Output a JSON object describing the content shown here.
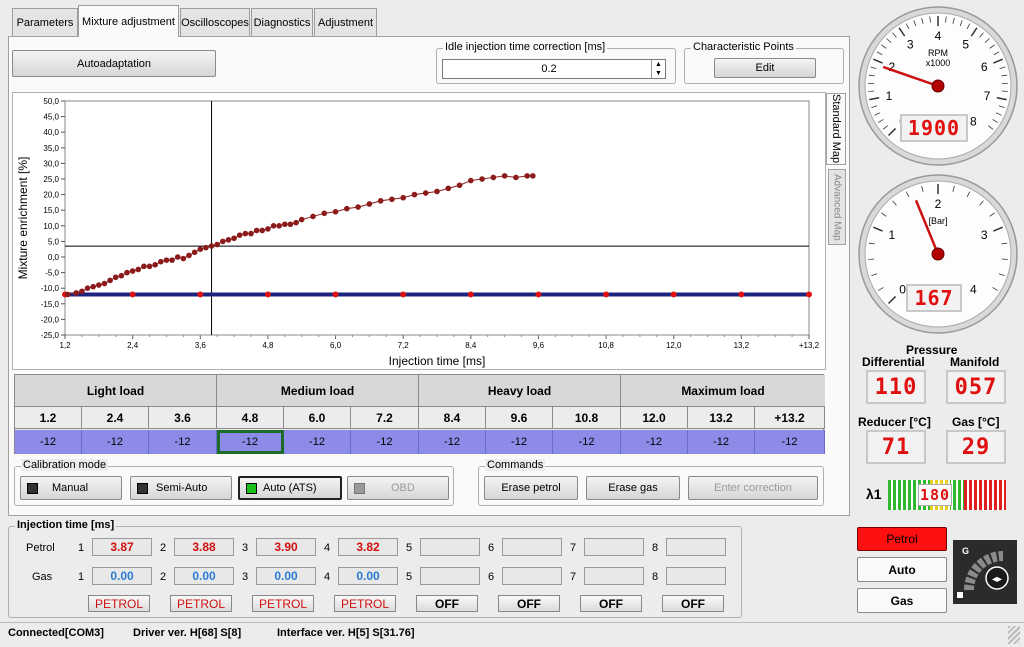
{
  "tabs": [
    "Parameters",
    "Mixture adjustment",
    "Oscilloscopes",
    "Diagnostics",
    "Adjustment"
  ],
  "autoadaptation_label": "Autoadaptation",
  "idle": {
    "title": "Idle injection time correction [ms]",
    "value": "0.2"
  },
  "characteristic": {
    "title": "Characteristic Points",
    "edit_label": "Edit"
  },
  "side_tabs": {
    "standard": "Standard Map",
    "advanced": "Advanced Map"
  },
  "chart_data": {
    "type": "scatter",
    "xlabel": "Injection time [ms]",
    "ylabel": "Mixture enrichment [%]",
    "x_ticks": [
      "1,2",
      "2,4",
      "3,6",
      "4,8",
      "6,0",
      "7,2",
      "8,4",
      "9,6",
      "10,8",
      "12,0",
      "13,2",
      "+13,2"
    ],
    "y_ticks": [
      "50,0",
      "45,0",
      "40,0",
      "35,0",
      "30,0",
      "25,0",
      "20,0",
      "15,0",
      "10,0",
      "5,0",
      "0,0",
      "-5,0",
      "-10,0",
      "-15,0",
      "-20,0",
      "-25,0"
    ],
    "xlim": [
      1.2,
      14.4
    ],
    "ylim": [
      -25,
      50
    ],
    "cursor": {
      "x": 3.8,
      "y": 3.5
    },
    "series": [
      {
        "type": "scatter",
        "color": "#8b1a1a",
        "x": [
          1.25,
          1.4,
          1.5,
          1.6,
          1.7,
          1.8,
          1.9,
          2.0,
          2.1,
          2.2,
          2.3,
          2.4,
          2.5,
          2.6,
          2.7,
          2.8,
          2.9,
          3.0,
          3.1,
          3.2,
          3.3,
          3.4,
          3.5,
          3.6,
          3.7,
          3.8,
          3.9,
          4.0,
          4.1,
          4.2,
          4.3,
          4.4,
          4.5,
          4.6,
          4.7,
          4.8,
          4.9,
          5.0,
          5.1,
          5.2,
          5.3,
          5.4,
          5.6,
          5.8,
          6.0,
          6.2,
          6.4,
          6.6,
          6.8,
          7.0,
          7.2,
          7.4,
          7.6,
          7.8,
          8.0,
          8.2,
          8.4,
          8.6,
          8.8,
          9.0,
          9.2,
          9.4,
          9.5
        ],
        "y": [
          -12,
          -11.5,
          -11,
          -10,
          -9.5,
          -9,
          -8.5,
          -7.5,
          -6.5,
          -6,
          -5,
          -4.5,
          -4,
          -3,
          -3,
          -2.5,
          -1.5,
          -1,
          -1,
          0,
          -0.5,
          0.5,
          1.5,
          2.5,
          3,
          3.5,
          4,
          5,
          5.5,
          6,
          7,
          7.5,
          7.5,
          8.5,
          8.5,
          9,
          10,
          10,
          10.5,
          10.5,
          11,
          12,
          13,
          14,
          14.5,
          15.5,
          16,
          17,
          18,
          18.5,
          19,
          20,
          20.5,
          21,
          22,
          23,
          24.5,
          25,
          25.5,
          26,
          25.5,
          26,
          26
        ]
      },
      {
        "type": "line",
        "color": "#1a237e",
        "x": [
          1.2,
          2.4,
          3.6,
          4.8,
          6.0,
          7.2,
          8.4,
          9.6,
          10.8,
          12.0,
          13.2,
          14.4
        ],
        "y": [
          -12,
          -12,
          -12,
          -12,
          -12,
          -12,
          -12,
          -12,
          -12,
          -12,
          -12,
          -12
        ]
      }
    ]
  },
  "load_groups": [
    "Light load",
    "Medium load",
    "Heavy load",
    "Maximum load"
  ],
  "rpm_cols": [
    "1.2",
    "2.4",
    "3.6",
    "4.8",
    "6.0",
    "7.2",
    "8.4",
    "9.6",
    "10.8",
    "12.0",
    "13.2",
    "+13.2"
  ],
  "rpm_vals": [
    "-12",
    "-12",
    "-12",
    "-12",
    "-12",
    "-12",
    "-12",
    "-12",
    "-12",
    "-12",
    "-12",
    "-12"
  ],
  "calibration": {
    "title": "Calibration mode",
    "buttons": [
      "Manual",
      "Semi-Auto",
      "Auto (ATS)",
      "OBD"
    ]
  },
  "commands": {
    "title": "Commands",
    "buttons": [
      "Erase petrol",
      "Erase gas",
      "Enter correction"
    ]
  },
  "injection": {
    "title": "Injection time [ms]",
    "petrol_label": "Petrol",
    "gas_label": "Gas",
    "nums": [
      "1",
      "2",
      "3",
      "4",
      "5",
      "6",
      "7",
      "8"
    ],
    "petrol": [
      "3.87",
      "3.88",
      "3.90",
      "3.82",
      "",
      "",
      "",
      ""
    ],
    "gas": [
      "0.00",
      "0.00",
      "0.00",
      "0.00",
      "",
      "",
      "",
      ""
    ],
    "fuel": [
      "PETROL",
      "PETROL",
      "PETROL",
      "PETROL",
      "OFF",
      "OFF",
      "OFF",
      "OFF"
    ]
  },
  "status": {
    "connected": "Connected[COM3]",
    "driver": "Driver ver. H[68] S[8]",
    "interface": "Interface ver. H[5] S[31.76]"
  },
  "rpm_gauge": {
    "unit": "RPM",
    "mult": "x1000",
    "ticks": [
      "0",
      "1",
      "2",
      "3",
      "4",
      "5",
      "6",
      "7",
      "8"
    ],
    "value_display": "1900",
    "value": 1.9
  },
  "bar_gauge": {
    "unit": "[Bar]",
    "ticks": [
      "0",
      "1",
      "2",
      "3",
      "4"
    ],
    "value_display": "167",
    "value": 1.67
  },
  "pressure": {
    "title": "Pressure",
    "differential": "Differential",
    "manifold": "Manifold",
    "diff_val": "110",
    "manifold_val": "057"
  },
  "temps": {
    "reducer": "Reducer [°C]",
    "gas": "Gas [°C]",
    "reducer_val": "71",
    "gas_val": "29"
  },
  "lambda": {
    "label": "λ1",
    "value": "180"
  },
  "fuel_select": [
    "Petrol",
    "Auto",
    "Gas"
  ],
  "switch_letter": "G",
  "colors": {
    "accent_red": "#e01010",
    "table_blue": "#8c8ce8",
    "map_line": "#1a237e",
    "points": "#8b1a1a"
  }
}
